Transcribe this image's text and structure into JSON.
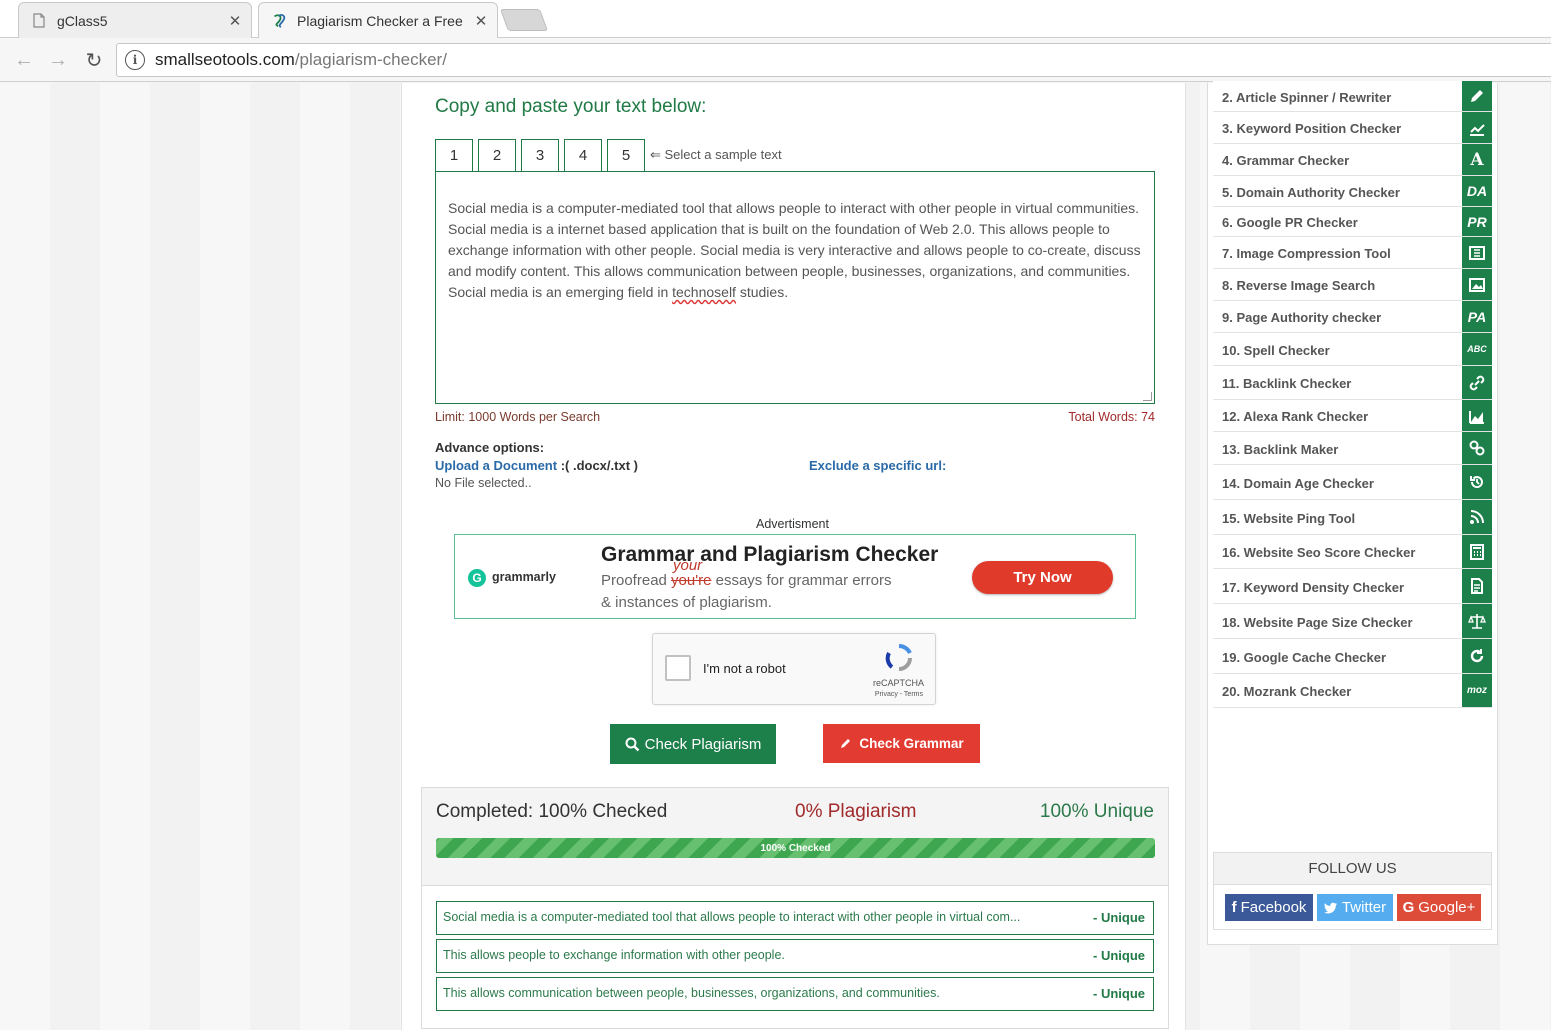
{
  "browser": {
    "tabs": [
      {
        "title": "gClass5",
        "active": false
      },
      {
        "title": "Plagiarism Checker a Free",
        "active": true
      }
    ],
    "url_domain": "smallseotools.com",
    "url_path": "/plagiarism-checker/"
  },
  "main": {
    "heading": "Copy and paste your text below:",
    "sample_tabs": [
      "1",
      "2",
      "3",
      "4",
      "5"
    ],
    "sample_hint": "⇐ Select a sample text",
    "text_before": "Social media is a computer-mediated tool that allows people to interact with other people in virtual communities. Social media is a internet based application that is built on the foundation of Web 2.0. This allows people to exchange information with other people. Social media is very interactive and allows people to co-create, discuss and modify content. This allows communication between people, businesses, organizations, and communities. Social media is an emerging field in ",
    "text_misspelled": "technoself",
    "text_after": " studies.",
    "limit": "Limit: 1000 Words per Search",
    "total_words": "Total Words: 74",
    "advance_title": "Advance options:",
    "upload_label": "Upload a Document",
    "upload_formats": " :( .docx/.txt )",
    "no_file": "No File selected..",
    "exclude_label": "Exclude a specific url:"
  },
  "ad": {
    "label": "Advertisment",
    "brand": "grammarly",
    "title": "Grammar and Plagiarism Checker",
    "line1_prefix": "Proofread ",
    "line1_struck": "you're",
    "line1_insert": "your",
    "line1_suffix": " essays for grammar errors",
    "line2": "& instances of plagiarism.",
    "cta": "Try Now"
  },
  "captcha": {
    "label": "I'm not a robot",
    "brand": "reCAPTCHA",
    "terms": "Privacy - Terms"
  },
  "buttons": {
    "check_plagiarism": "Check Plagiarism",
    "check_grammar": "Check Grammar"
  },
  "result": {
    "completed": "Completed: 100% Checked",
    "plagiarism": "0% Plagiarism",
    "unique": "100% Unique",
    "progress_label": "100% Checked",
    "progress_fraction": 1.0,
    "rows": [
      {
        "text": "Social media is a computer-mediated tool that allows people to interact with other people in virtual com...",
        "status": "- Unique"
      },
      {
        "text": "This allows people to exchange information with other people.",
        "status": "- Unique"
      },
      {
        "text": "This allows communication between people, businesses, organizations, and communities.",
        "status": "- Unique"
      }
    ]
  },
  "sidebar": {
    "items": [
      {
        "label": "2. Article Spinner / Rewriter",
        "icon": "pencil-icon"
      },
      {
        "label": "3. Keyword Position Checker",
        "icon": "trend-chart-icon"
      },
      {
        "label": "4. Grammar Checker",
        "icon": "letter-a-icon",
        "icon_text": "A"
      },
      {
        "label": "5. Domain Authority Checker",
        "icon": "da-icon",
        "icon_text": "DA"
      },
      {
        "label": "6. Google PR Checker",
        "icon": "pr-icon",
        "icon_text": "PR"
      },
      {
        "label": "7. Image Compression Tool",
        "icon": "compress-icon"
      },
      {
        "label": "8. Reverse Image Search",
        "icon": "image-icon"
      },
      {
        "label": "9. Page Authority checker",
        "icon": "pa-icon",
        "icon_text": "PA"
      },
      {
        "label": "10. Spell Checker",
        "icon": "abc-icon",
        "icon_text": "ABC"
      },
      {
        "label": "11. Backlink Checker",
        "icon": "link-icon"
      },
      {
        "label": "12. Alexa Rank Checker",
        "icon": "area-chart-icon"
      },
      {
        "label": "13. Backlink Maker",
        "icon": "chain-icon"
      },
      {
        "label": "14. Domain Age Checker",
        "icon": "history-icon"
      },
      {
        "label": "15. Website Ping Tool",
        "icon": "rss-icon"
      },
      {
        "label": "16. Website Seo Score Checker",
        "icon": "calculator-icon"
      },
      {
        "label": "17. Keyword Density Checker",
        "icon": "document-icon"
      },
      {
        "label": "18. Website Page Size Checker",
        "icon": "scale-icon"
      },
      {
        "label": "19. Google Cache Checker",
        "icon": "refresh-icon"
      },
      {
        "label": "20. Mozrank Checker",
        "icon": "moz-icon",
        "icon_text": "moz"
      }
    ],
    "follow_title": "FOLLOW US",
    "social": {
      "facebook": "Facebook",
      "twitter": "Twitter",
      "google": "Google+"
    }
  }
}
